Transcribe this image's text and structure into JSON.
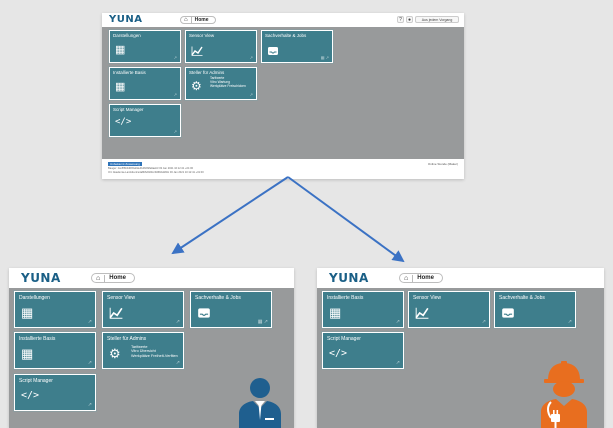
{
  "top": {
    "logo": "YUNA",
    "home_icon": "home-icon",
    "home_label": "Home",
    "top_right": {
      "help_icon": "question-icon",
      "user_icon": "user-icon",
      "menu_label": "Aus jedem Vorgang"
    },
    "tiles": [
      {
        "title": "Darstellungen",
        "icon": "table-icon"
      },
      {
        "title": "Sensor View",
        "icon": "chart-line-icon"
      },
      {
        "title": "Sachverhalte & Jobs",
        "icon": "inbox-icon"
      },
      {
        "title": "Installierte Basis",
        "icon": "table-icon"
      },
      {
        "title": "Steller für Admins",
        "icon": "gear-icon",
        "sub": [
          "Tarifwerte",
          "Vitro Wartung",
          "Werkplätze Freischicken"
        ]
      },
      {
        "title": "Script Manager",
        "icon": "code-icon"
      }
    ],
    "footer": {
      "tag": "Unbekannt Zuweisung",
      "line1": "Bauger: ilce5f6b0d0b5a6de4b4b6b8a9aeb3 03 Jan 2021 10:12:41 +01:00",
      "line2": "Ort: Akademie-Lambda ilce4a8b6d0d3cc9d6b0a9b9c 03 Jan 2021 10:12:41 +01:00",
      "right": "Online Stunde (Maker)"
    }
  },
  "left": {
    "logo": "YUNA",
    "home_icon": "home-icon",
    "home_label": "Home",
    "tiles": [
      {
        "title": "Darstellungen",
        "icon": "table-icon"
      },
      {
        "title": "Sensor View",
        "icon": "chart-line-icon"
      },
      {
        "title": "Sachverhalte & Jobs",
        "icon": "inbox-icon"
      },
      {
        "title": "Installierte Basis",
        "icon": "table-icon"
      },
      {
        "title": "Steller für Admins",
        "icon": "gear-icon",
        "sub": [
          "Tarifwerte",
          "Vitro Übersicht",
          "Werkplätze Freihelt-Verfiten"
        ]
      },
      {
        "title": "Script Manager",
        "icon": "code-icon"
      }
    ],
    "persona_icon": "businessman-icon"
  },
  "right": {
    "logo": "YUNA",
    "home_icon": "home-icon",
    "home_label": "Home",
    "tiles": [
      {
        "title": "Installierte Basis",
        "icon": "table-icon"
      },
      {
        "title": "Sensor View",
        "icon": "chart-line-icon"
      },
      {
        "title": "Sachverhalte & Jobs",
        "icon": "inbox-icon"
      },
      {
        "title": "Script Manager",
        "icon": "code-icon"
      }
    ],
    "persona_icon": "technician-icon"
  },
  "colors": {
    "tile": "#3e7e8c",
    "area": "#989a9b",
    "logo": "#1a5f86",
    "arrow": "#3b72c4",
    "persona_blue": "#1f5f8f",
    "persona_orange": "#e86e1f"
  }
}
